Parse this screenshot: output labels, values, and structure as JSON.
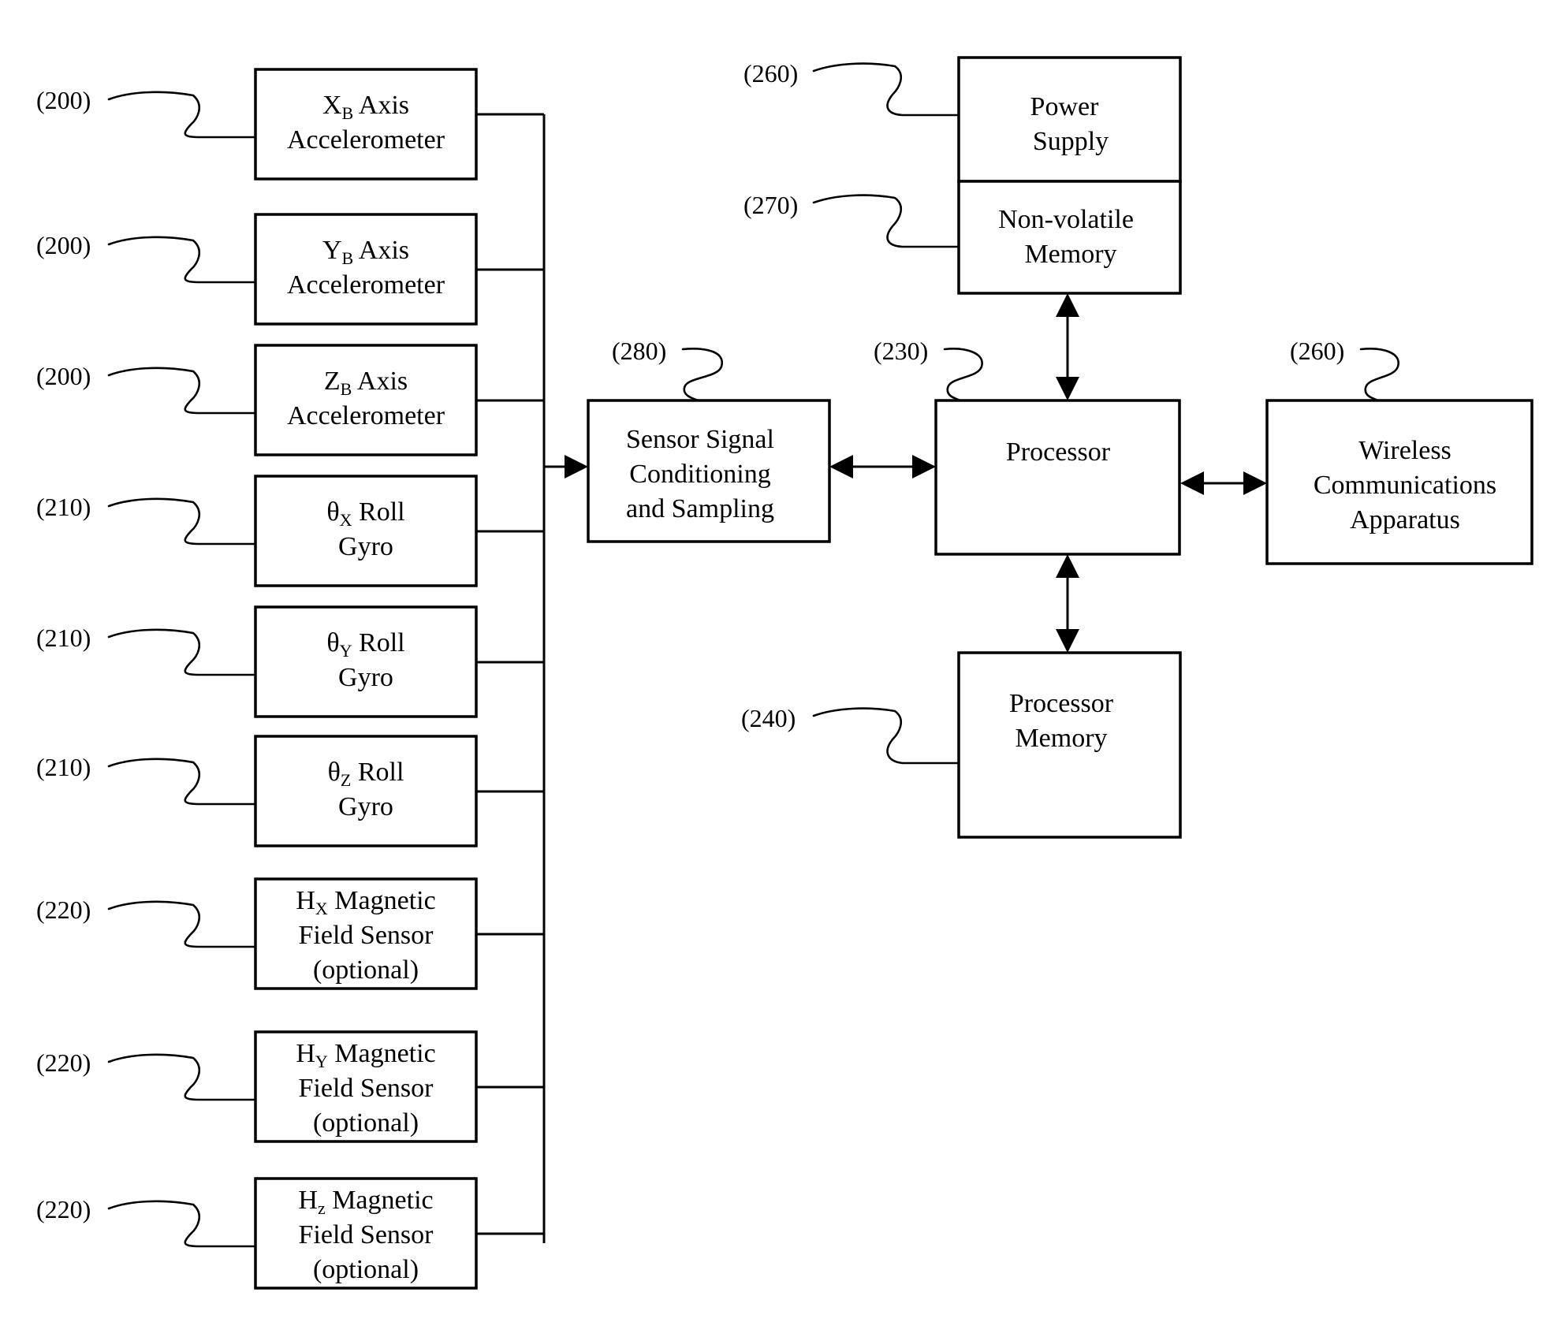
{
  "figure": {
    "sensors": [
      {
        "ref": "(200)",
        "symbol": "X",
        "subscript": "B",
        "line1_rest": " Axis",
        "line2": "Accelerometer",
        "line3": ""
      },
      {
        "ref": "(200)",
        "symbol": "Y",
        "subscript": "B",
        "line1_rest": " Axis",
        "line2": "Accelerometer",
        "line3": ""
      },
      {
        "ref": "(200)",
        "symbol": "Z",
        "subscript": "B",
        "line1_rest": " Axis",
        "line2": "Accelerometer",
        "line3": ""
      },
      {
        "ref": "(210)",
        "symbol": "θ",
        "subscript": "X",
        "line1_rest": " Roll",
        "line2": "Gyro",
        "line3": ""
      },
      {
        "ref": "(210)",
        "symbol": "θ",
        "subscript": "Y",
        "line1_rest": " Roll",
        "line2": "Gyro",
        "line3": ""
      },
      {
        "ref": "(210)",
        "symbol": "θ",
        "subscript": "Z",
        "line1_rest": " Roll",
        "line2": "Gyro",
        "line3": ""
      },
      {
        "ref": "(220)",
        "symbol": "H",
        "subscript": "X",
        "line1_rest": " Magnetic",
        "line2": "Field Sensor",
        "line3": "(optional)"
      },
      {
        "ref": "(220)",
        "symbol": "H",
        "subscript": "Y",
        "line1_rest": " Magnetic",
        "line2": "Field Sensor",
        "line3": "(optional)"
      },
      {
        "ref": "(220)",
        "symbol": "H",
        "subscript": "z",
        "line1_rest": " Magnetic",
        "line2": "Field Sensor",
        "line3": "(optional)"
      }
    ],
    "signal_conditioning": {
      "ref": "(280)",
      "lines": [
        "Sensor Signal",
        "Conditioning",
        "and Sampling"
      ]
    },
    "processor": {
      "ref": "(230)",
      "lines": [
        "Processor"
      ]
    },
    "power_supply": {
      "ref": "(260)",
      "lines": [
        "Power",
        "Supply"
      ]
    },
    "nonvolatile_memory": {
      "ref": "(270)",
      "lines": [
        "Non-volatile",
        "Memory"
      ]
    },
    "processor_memory": {
      "ref": "(240)",
      "lines": [
        "Processor",
        "Memory"
      ]
    },
    "wireless": {
      "ref": "(260)",
      "lines": [
        "Wireless",
        "Communications",
        "Apparatus"
      ]
    }
  }
}
